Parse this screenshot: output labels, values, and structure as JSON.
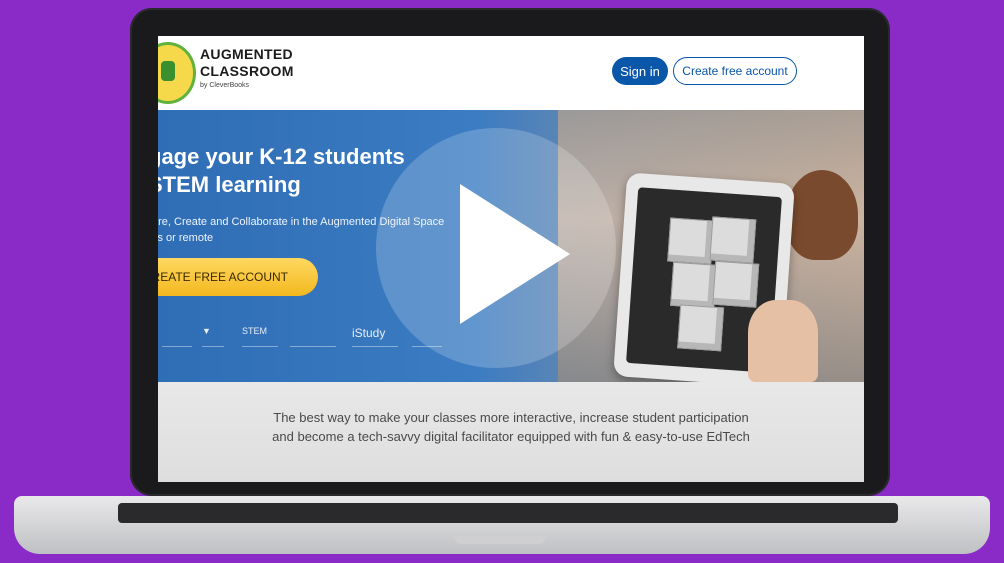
{
  "colors": {
    "background": "#8a2bc8",
    "primary": "#0a56a8",
    "cta": "#f3b81f",
    "hero_blue": "#2f6db5"
  },
  "logo": {
    "line1": "AUGMENTED",
    "line2": "CLASSROOM",
    "sub": "by CleverBooks"
  },
  "header": {
    "signin_label": "Sign in",
    "create_label": "Create free account"
  },
  "hero": {
    "title_line1": "gage your K-12 students",
    "title_line2": "STEM learning",
    "subtitle_line1": "ore, Create and Collaborate in the Augmented Digital Space",
    "subtitle_line2": "ss or remote",
    "cta_label": "CREATE FREE ACCOUNT",
    "partner_logos": [
      "STEM",
      "iStudy"
    ]
  },
  "video": {
    "play_icon": "play-icon"
  },
  "tagline": {
    "line1": "The best way to make your classes more interactive, increase student participation",
    "line2": "and become a tech-savvy digital facilitator equipped with fun & easy-to-use EdTech"
  }
}
